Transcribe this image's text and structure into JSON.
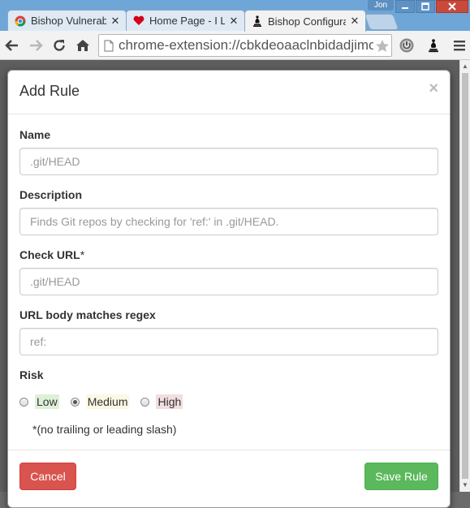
{
  "browser": {
    "tabs": [
      {
        "title": "Bishop Vulnerabili",
        "favicon": "chrome-icon",
        "active": false
      },
      {
        "title": "Home Page - I Lo",
        "favicon": "heart-icon",
        "active": false
      },
      {
        "title": "Bishop Configura",
        "favicon": "bishop-icon",
        "active": true
      }
    ],
    "user": "Jon",
    "address": "chrome-extension://cbkdeoaaclnbidadjimofi",
    "window_controls": [
      "minimize",
      "maximize",
      "close"
    ]
  },
  "modal": {
    "title": "Add Rule",
    "close_symbol": "×",
    "fields": {
      "name": {
        "label": "Name",
        "placeholder": ".git/HEAD"
      },
      "description": {
        "label": "Description",
        "placeholder": "Finds Git repos by checking for 'ref:' in .git/HEAD."
      },
      "check_url": {
        "label": "Check URL",
        "required_mark": "*",
        "placeholder": ".git/HEAD"
      },
      "regex": {
        "label": "URL body matches regex",
        "placeholder": "ref:"
      }
    },
    "risk": {
      "label": "Risk",
      "options": [
        {
          "label": "Low",
          "bg": "#dff0d8",
          "checked": false
        },
        {
          "label": "Medium",
          "bg": "#fcf8e3",
          "checked": true
        },
        {
          "label": "High",
          "bg": "#f2dede",
          "checked": false
        }
      ]
    },
    "note": "*(no trailing or leading slash)",
    "buttons": {
      "cancel": "Cancel",
      "save": "Save Rule"
    }
  },
  "colors": {
    "danger": "#d9534f",
    "success": "#5cb85c",
    "chrome_frame": "#6fa6d8"
  }
}
